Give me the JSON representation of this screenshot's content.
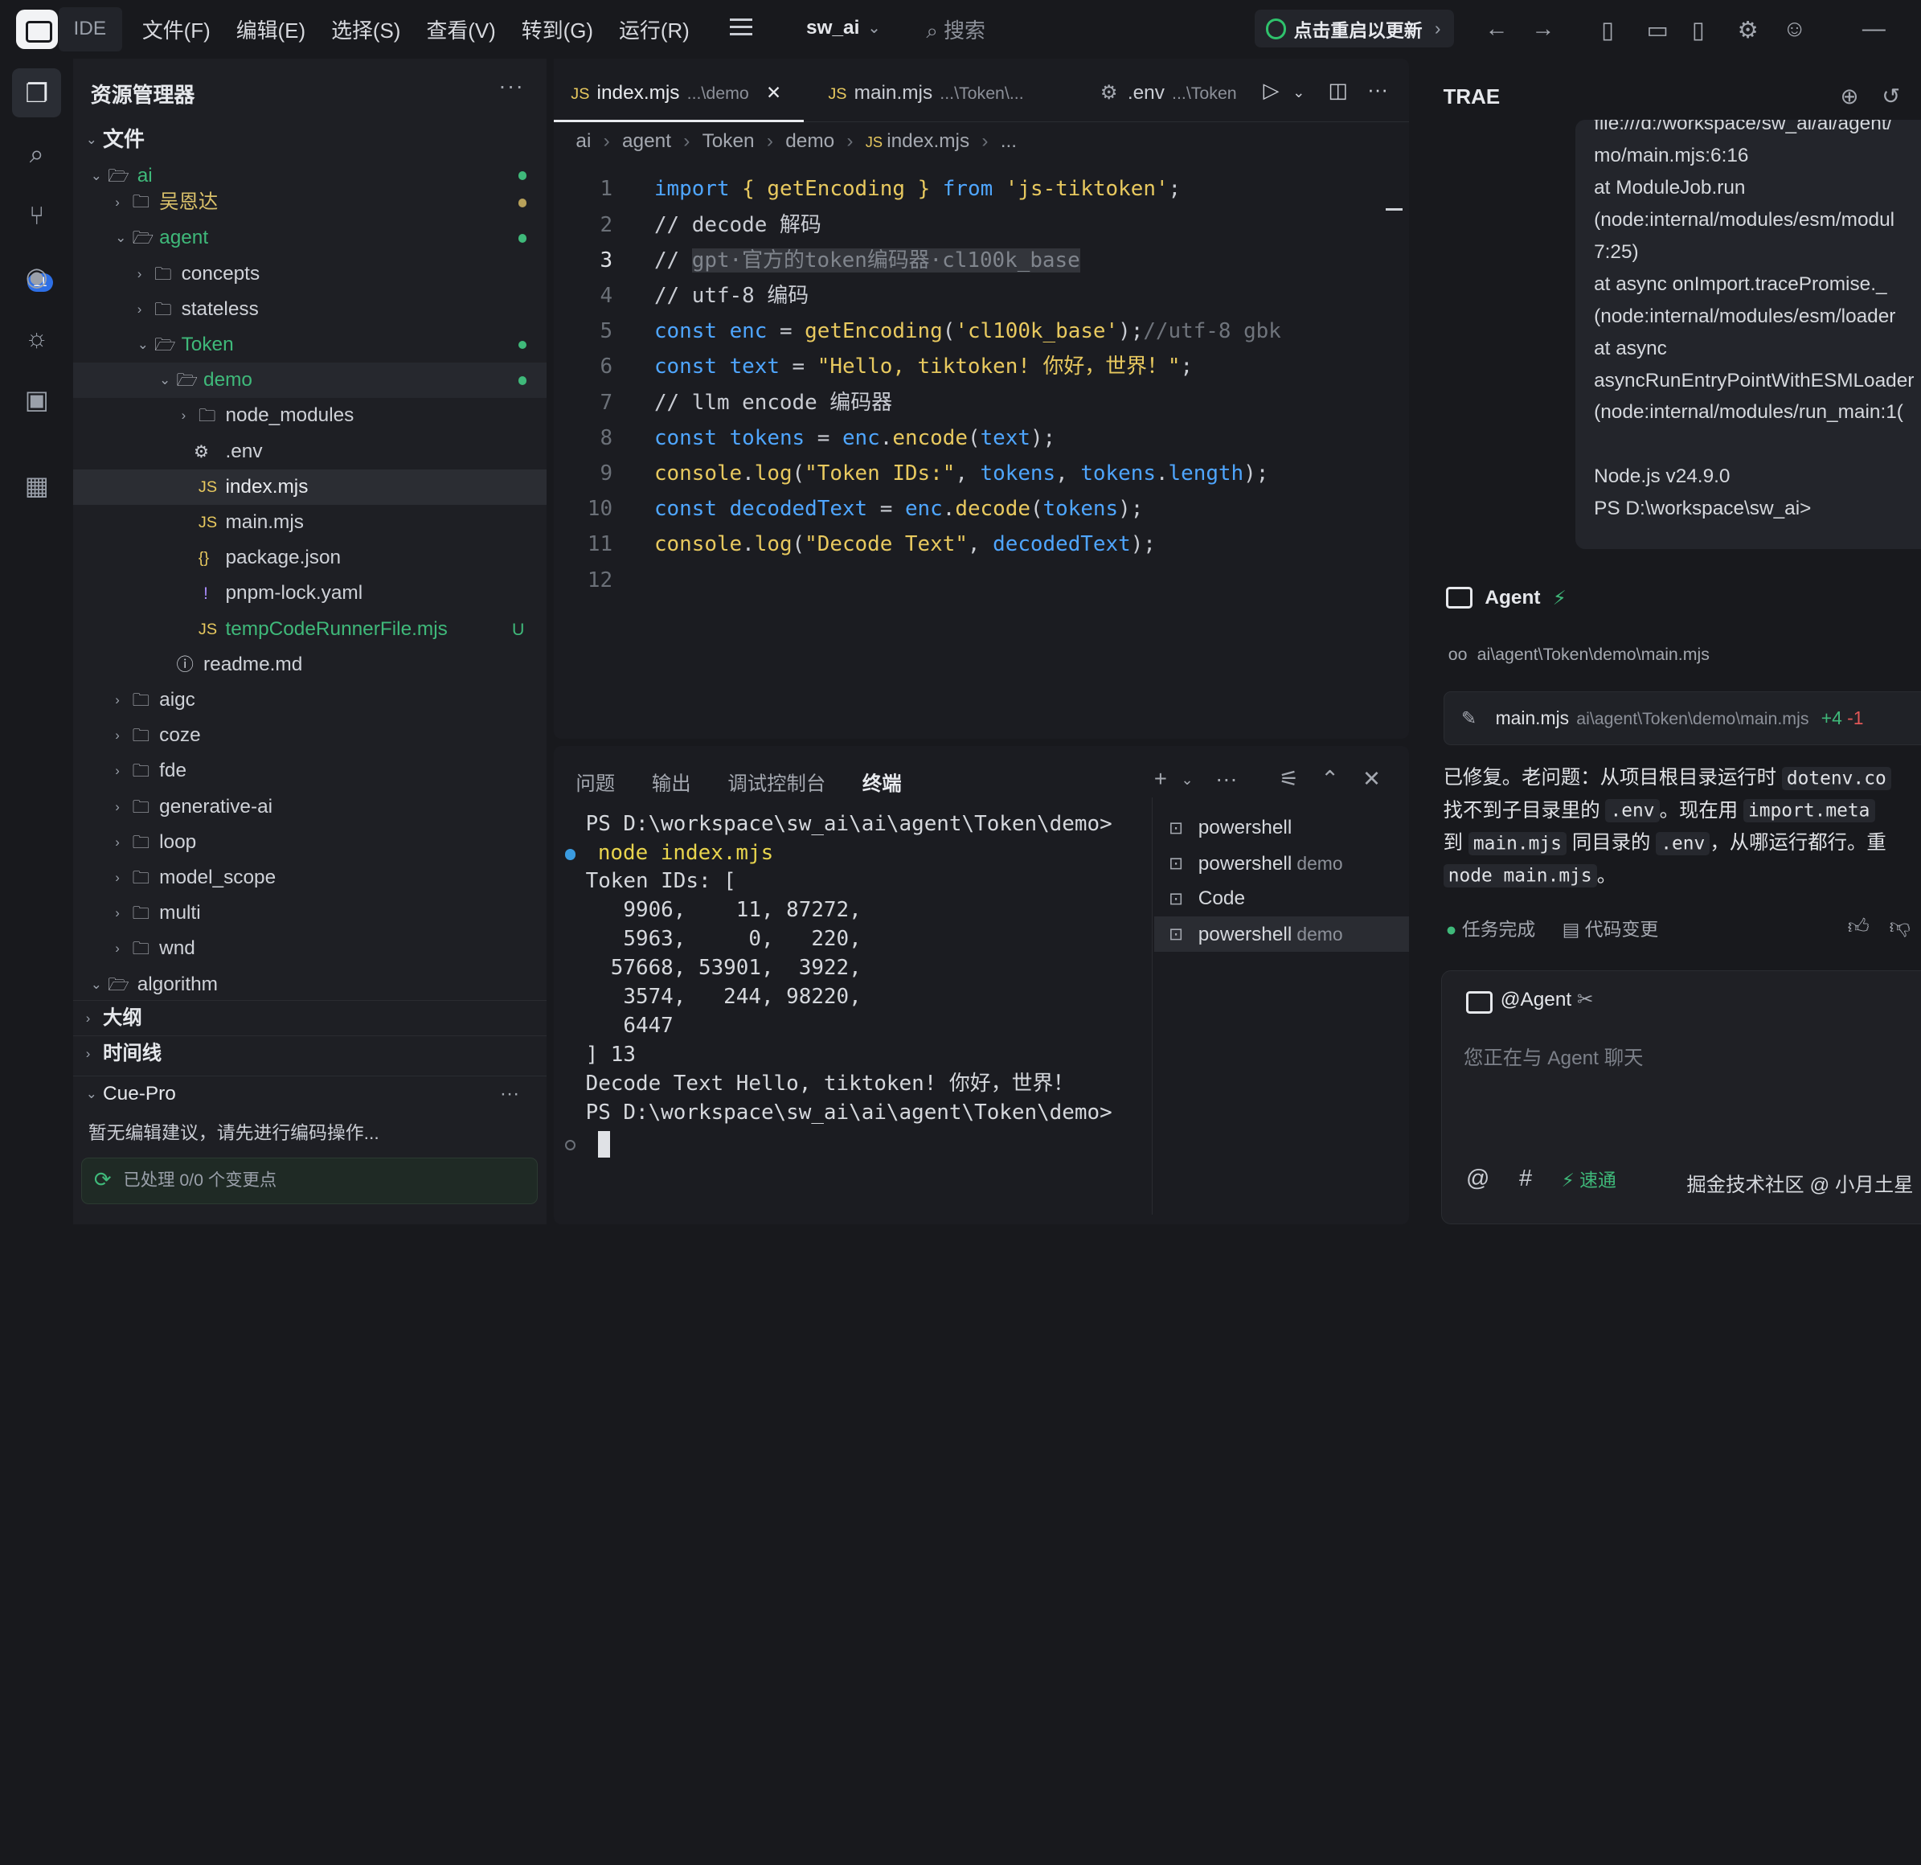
{
  "titlebar": {
    "ide_tag": "IDE",
    "menus": [
      "文件(F)",
      "编辑(E)",
      "选择(S)",
      "查看(V)",
      "转到(G)",
      "运行(R)"
    ],
    "project": "sw_ai",
    "search_placeholder": "搜索",
    "update_label": "点击重启以更新"
  },
  "activity": {
    "scm_badge": "11"
  },
  "sidebar": {
    "title": "资源管理器",
    "files_section": "文件",
    "tree": {
      "ai": "ai",
      "wuenda": "吴恩达",
      "agent": "agent",
      "concepts": "concepts",
      "stateless": "stateless",
      "token": "Token",
      "demo": "demo",
      "node_modules": "node_modules",
      "env": ".env",
      "index_mjs": "index.mjs",
      "main_mjs": "main.mjs",
      "package_json": "package.json",
      "pnpm_lock": "pnpm-lock.yaml",
      "temp_runner": "tempCodeRunnerFile.mjs",
      "temp_runner_status": "U",
      "readme": "readme.md",
      "aigc": "aigc",
      "coze": "coze",
      "fde": "fde",
      "generative_ai": "generative-ai",
      "loop": "loop",
      "model_scope": "model_scope",
      "multi": "multi",
      "wnd": "wnd",
      "algorithm": "algorithm"
    },
    "outline_section": "大纲",
    "timeline_section": "时间线",
    "cue_section": "Cue-Pro",
    "cue_hint": "暂无编辑建议，请先进行编码操作...",
    "cue_status": "已处理 0/0 个变更点"
  },
  "editor": {
    "tabs": [
      {
        "name": "index.mjs",
        "path": "...\\demo"
      },
      {
        "name": "main.mjs",
        "path": "...\\Token\\..."
      },
      {
        "name": ".env",
        "path": "...\\Token"
      }
    ],
    "breadcrumbs": [
      "ai",
      "agent",
      "Token",
      "demo",
      "index.mjs",
      "..."
    ],
    "line_numbers": [
      "1",
      "2",
      "3",
      "4",
      "5",
      "6",
      "7",
      "8",
      "9",
      "10",
      "11",
      "12"
    ]
  },
  "panel": {
    "tabs": [
      "问题",
      "输出",
      "调试控制台",
      "终端"
    ],
    "terminal_lines": [
      "PS D:\\workspace\\sw_ai\\ai\\agent\\Token\\demo>",
      "node index.mjs",
      "Token IDs: [",
      "   9906,    11, 87272,",
      "   5963,     0,   220,",
      "  57668, 53901,  3922,",
      "   3574,   244, 98220,",
      "   6447",
      "] 13",
      "Decode Text Hello, tiktoken! 你好，世界！",
      "PS D:\\workspace\\sw_ai\\ai\\agent\\Token\\demo>"
    ],
    "terminals": [
      {
        "name": "powershell",
        "sub": ""
      },
      {
        "name": "powershell",
        "sub": "demo"
      },
      {
        "name": "Code",
        "sub": ""
      },
      {
        "name": "powershell",
        "sub": "demo"
      }
    ]
  },
  "ai": {
    "title": "TRAE",
    "output_lines": [
      "file:///d:/workspace/sw_ai/ai/agent/",
      "mo/main.mjs:6:16",
      "    at ModuleJob.run",
      "(node:internal/modules/esm/modul",
      "7:25)",
      "    at async onImport.tracePromise._",
      "(node:internal/modules/esm/loader",
      "    at async",
      "asyncRunEntryPointWithESMLoader",
      "(node:internal/modules/run_main:1(",
      "",
      "Node.js v24.9.0",
      "PS D:\\workspace\\sw_ai>"
    ],
    "agent_label": "Agent",
    "file_ref": "ai\\agent\\Token\\demo\\main.mjs",
    "change": {
      "file": "main.mjs",
      "path": "ai\\agent\\Token\\demo\\main.mjs",
      "added": "+4",
      "removed": "-1"
    },
    "message": {
      "l1a": "已修复。老问题：从项目根目录运行时 ",
      "l1b": "dotenv.co",
      "l2a": "找不到子目录里的 ",
      "l2b": ".env",
      "l2c": "。现在用 ",
      "l2d": "import.meta",
      "l3a": "到 ",
      "l3b": "main.mjs",
      "l3c": " 同目录的 ",
      "l3d": ".env",
      "l3e": "，从哪运行都行。重",
      "l4a": "node main.mjs",
      "l4b": "。"
    },
    "task_done": "任务完成",
    "code_changes": "代码变更",
    "mention": "@Agent",
    "input_placeholder": "您正在与 Agent 聊天",
    "speed_label": "速通",
    "model_watermark": "掘金技术社区 @ 小月土星"
  },
  "colors": {
    "accent_green": "#3fb97a",
    "keyword_blue": "#4fa6ff",
    "string_yellow": "#e8c95f"
  }
}
